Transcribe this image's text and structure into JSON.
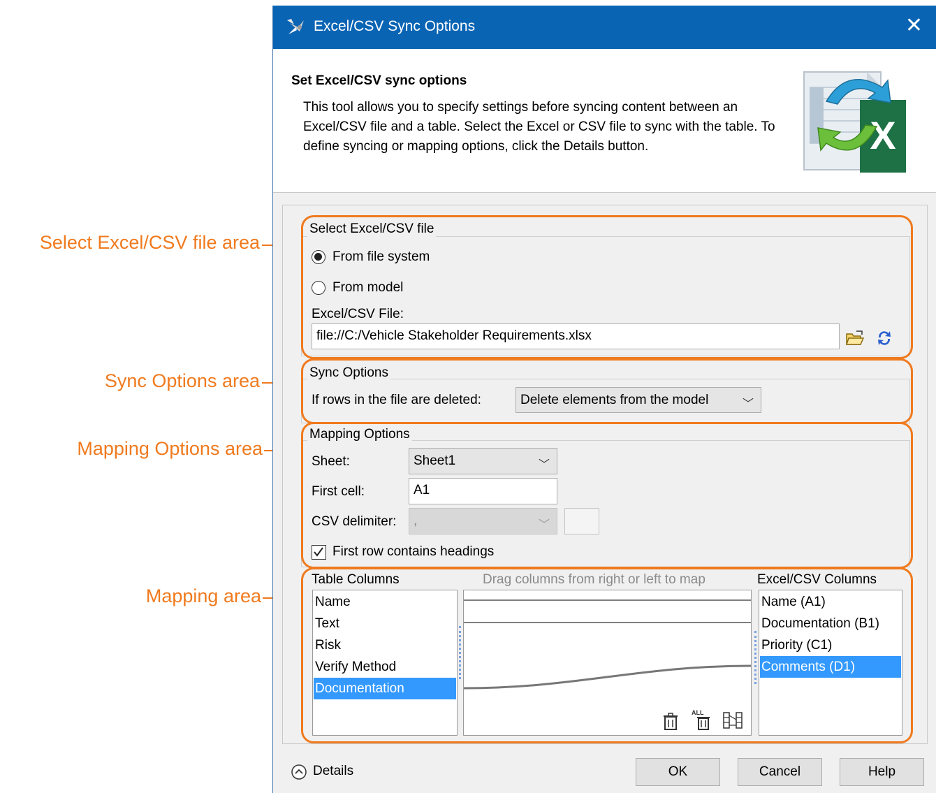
{
  "callouts": {
    "select_file_area": "Select Excel/CSV file area",
    "sync_options_area": "Sync Options area",
    "mapping_options_area": "Mapping Options area",
    "mapping_area": "Mapping area"
  },
  "window": {
    "title": "Excel/CSV Sync Options",
    "close_glyph": "✕"
  },
  "header": {
    "title": "Set Excel/CSV sync options",
    "description": "This tool allows you to specify settings before syncing content between an Excel/CSV file and a table. Select the Excel or CSV file to sync with the table. To define syncing or mapping options, click the Details button.",
    "icon_letter": "X"
  },
  "select_file": {
    "group_title": "Select Excel/CSV file",
    "radio_file_system": "From file system",
    "radio_model": "From model",
    "selected": "From file system",
    "file_label": "Excel/CSV File:",
    "file_value": "file://C:/Vehicle Stakeholder Requirements.xlsx"
  },
  "sync_options": {
    "group_title": "Sync Options",
    "deleted_rows_label": "If rows in the file are deleted:",
    "deleted_rows_value": "Delete elements from the model"
  },
  "mapping_options": {
    "group_title": "Mapping Options",
    "sheet_label": "Sheet:",
    "sheet_value": "Sheet1",
    "first_cell_label": "First cell:",
    "first_cell_value": "A1",
    "csv_delimiter_label": "CSV delimiter:",
    "csv_delimiter_value": ",",
    "headings_label": "First row contains headings",
    "headings_checked": true
  },
  "mapping": {
    "table_columns_title": "Table Columns",
    "drag_hint": "Drag columns from right or left to map",
    "excel_columns_title": "Excel/CSV Columns",
    "table_columns": [
      "Name",
      "Text",
      "Risk",
      "Verify Method",
      "Documentation"
    ],
    "table_selected": "Documentation",
    "excel_columns": [
      "Name (A1)",
      "Documentation (B1)",
      "Priority (C1)",
      "Comments (D1)"
    ],
    "excel_selected": "Comments (D1)",
    "tools": [
      "delete-icon",
      "delete-all-icon",
      "auto-map-icon"
    ],
    "all_badge": "ALL"
  },
  "footer": {
    "details_label": "Details",
    "ok_label": "OK",
    "cancel_label": "Cancel",
    "help_label": "Help"
  },
  "colors": {
    "accent_orange": "#f07a1e",
    "titlebar_blue": "#0a64b4",
    "selection_blue": "#3399ff",
    "excel_green": "#1e7145"
  }
}
